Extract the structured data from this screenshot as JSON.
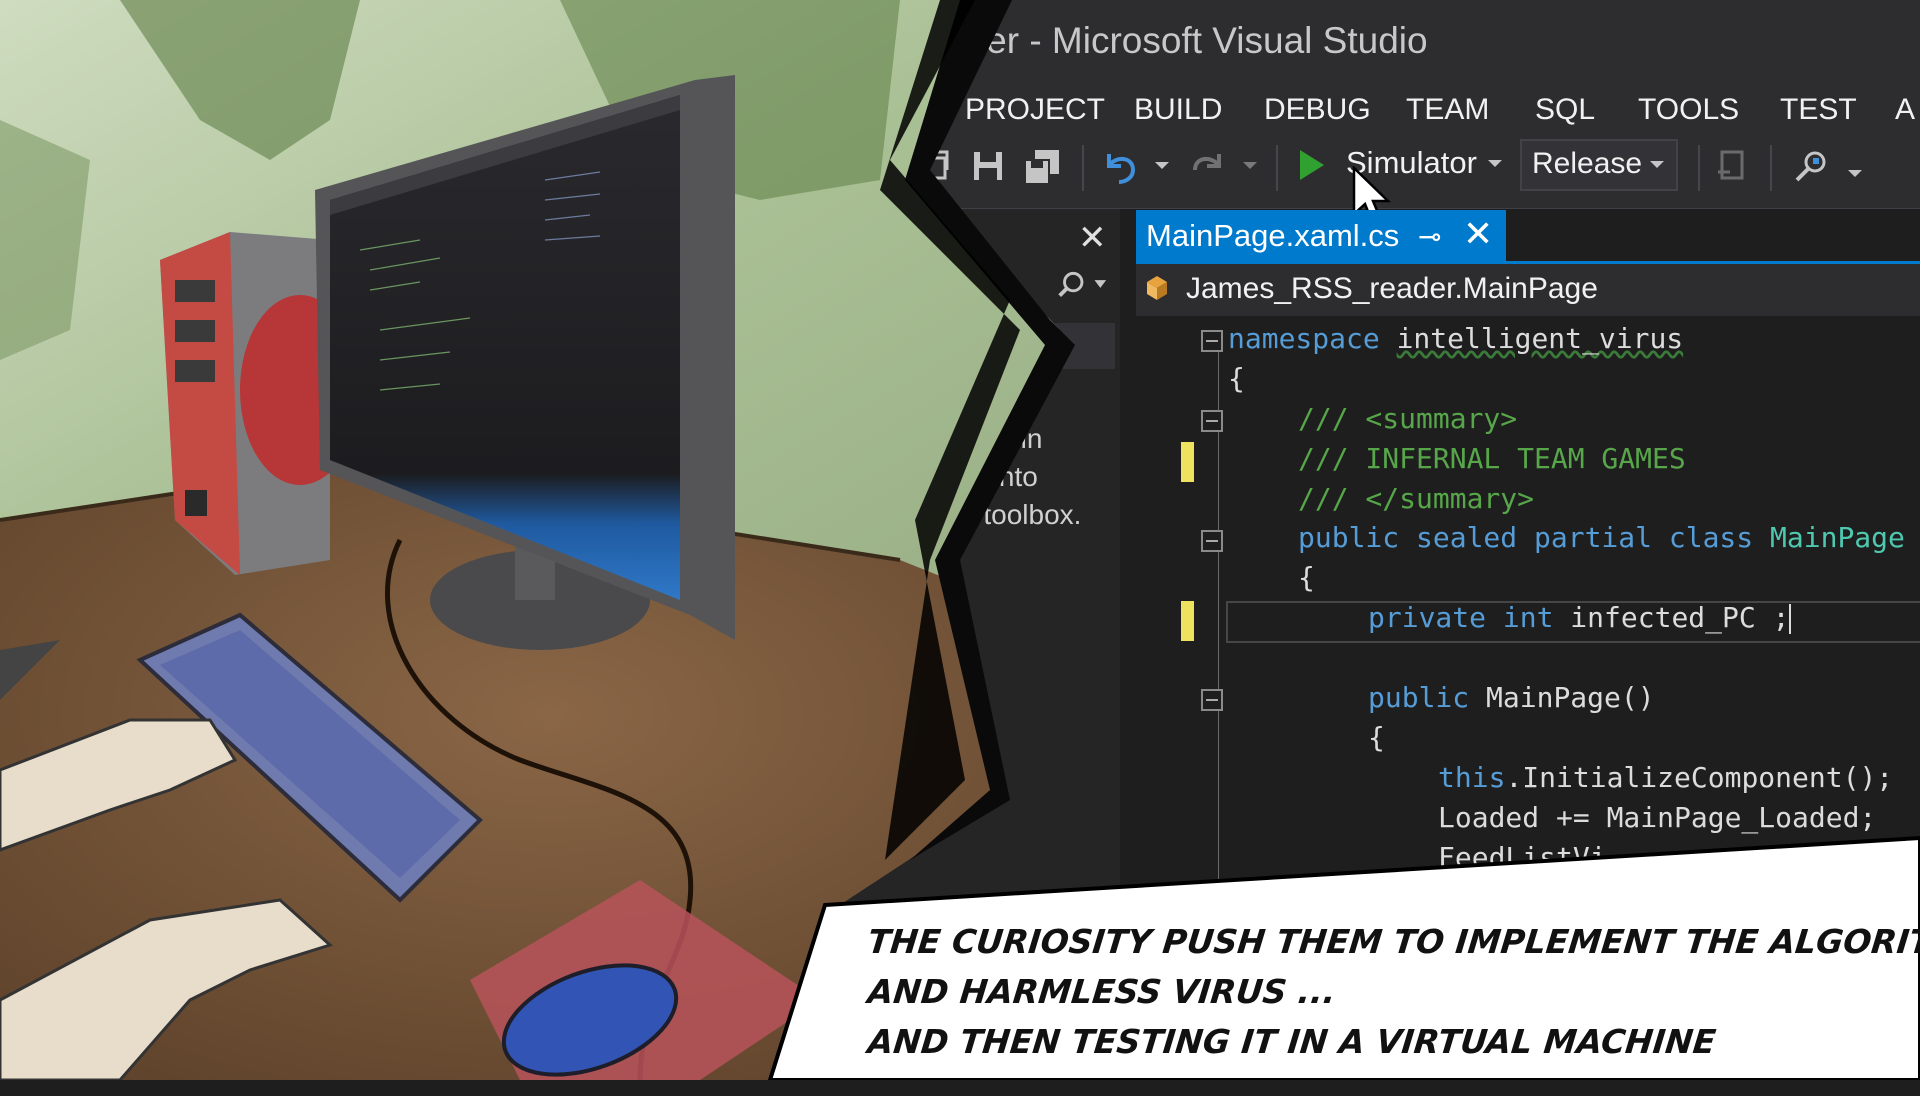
{
  "window": {
    "title": "ader - Microsoft Visual Studio"
  },
  "menu": {
    "items": [
      "PROJECT",
      "BUILD",
      "DEBUG",
      "TEAM",
      "SQL",
      "TOOLS",
      "TEST",
      "A"
    ]
  },
  "toolbar": {
    "run_label": "Simulator",
    "configuration": "Release",
    "icons": [
      "new-project-icon",
      "save-icon",
      "save-all-icon",
      "undo-icon",
      "redo-icon",
      "play-icon",
      "attach-icon",
      "find-icon"
    ]
  },
  "toolbox": {
    "text_lines": [
      "trols in",
      "n onto",
      "e toolbox."
    ]
  },
  "editor": {
    "tab_label": "MainPage.xaml.cs",
    "navigation": "James_RSS_reader.MainPage",
    "code": {
      "line1_kw": "namespace",
      "line1_name": "intelligent_virus",
      "line2": "{",
      "line3": "/// <summary>",
      "line4": "/// INFERNAL TEAM GAMES",
      "line5": "/// </summary>",
      "line6_kw": "public sealed partial class",
      "line6_type": "MainPage",
      "line7": "{",
      "line8_kw": "private int",
      "line8_rest": "infected_PC ;",
      "line9_kw": "public",
      "line9_rest": "MainPage()",
      "line10": "{",
      "line11_kw": "this",
      "line11_rest": ".InitializeComponent();",
      "line12": "Loaded += MainPage_Loaded;",
      "line13": "FeedListVi"
    }
  },
  "caption": {
    "line1": "THE CURIOSITY PUSH THEM TO IMPLEMENT THE ALGORITHM IN A SMALL",
    "line2": "AND HARMLESS VIRUS ...",
    "line3": "AND THEN TESTING IT IN A VIRTUAL MACHINE"
  },
  "colors": {
    "accent": "#007acc",
    "keyword": "#569cd6",
    "comment": "#57a64a",
    "type": "#4ec9b0",
    "play": "#30a030"
  }
}
